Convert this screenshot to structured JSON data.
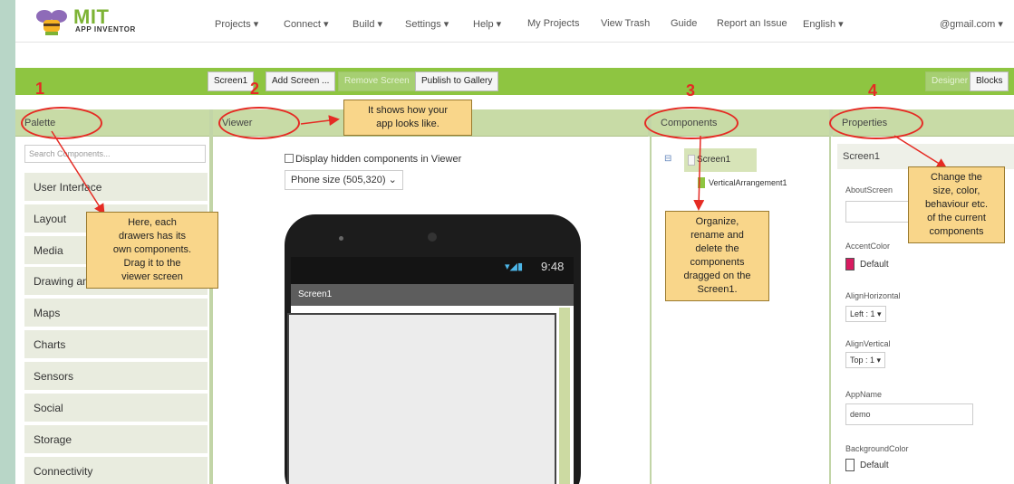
{
  "app": {
    "brand": "MIT",
    "brand_sub": "APP INVENTOR"
  },
  "topmenu": {
    "items": [
      "Projects ▾",
      "Connect ▾",
      "Build ▾",
      "Settings ▾",
      "Help ▾",
      "My Projects",
      "View Trash",
      "Guide",
      "Report an Issue",
      "English ▾",
      "@gmail.com ▾"
    ]
  },
  "toolbar": {
    "screen": "Screen1",
    "add_screen": "Add Screen ...",
    "remove_screen": "Remove Screen",
    "publish": "Publish to Gallery",
    "designer": "Designer",
    "blocks": "Blocks"
  },
  "numbers": [
    "1",
    "2",
    "3",
    "4"
  ],
  "palette": {
    "title": "Palette",
    "search_placeholder": "Search Components...",
    "items": [
      "User Interface",
      "Layout",
      "Media",
      "Drawing and Animation",
      "Maps",
      "Charts",
      "Sensors",
      "Social",
      "Storage",
      "Connectivity"
    ]
  },
  "viewer": {
    "title": "Viewer",
    "checkbox_label": "Display hidden components in Viewer",
    "size_select": "Phone size (505,320)",
    "phone_time": "9:48",
    "screen_title": "Screen1"
  },
  "components": {
    "title": "Components",
    "root": "Screen1",
    "child": "VerticalArrangement1"
  },
  "properties": {
    "title": "Properties",
    "selected": "Screen1",
    "about_label": "AboutScreen",
    "accent_label": "AccentColor",
    "accent_value": "Default",
    "accent_color": "#d81b60",
    "alignh_label": "AlignHorizontal",
    "alignh_value": "Left : 1 ▾",
    "alignv_label": "AlignVertical",
    "alignv_value": "Top : 1 ▾",
    "appname_label": "AppName",
    "appname_value": "demo",
    "bg_label": "BackgroundColor",
    "bg_value": "Default"
  },
  "notes": {
    "viewer": [
      "It shows how your",
      "app looks like."
    ],
    "palette": [
      "Here, each",
      "drawers has its",
      "own components.",
      "Drag it to the",
      "viewer screen"
    ],
    "components": [
      "Organize,",
      "rename and",
      "delete the",
      "components",
      "dragged on the",
      "Screen1."
    ],
    "properties": [
      "Change the",
      "size, color,",
      "behaviour etc.",
      "of the current",
      "components"
    ]
  },
  "colors": {
    "accent_green": "#8ec541",
    "annotation_red": "#e52b24",
    "note_bg": "#f9d68a"
  }
}
